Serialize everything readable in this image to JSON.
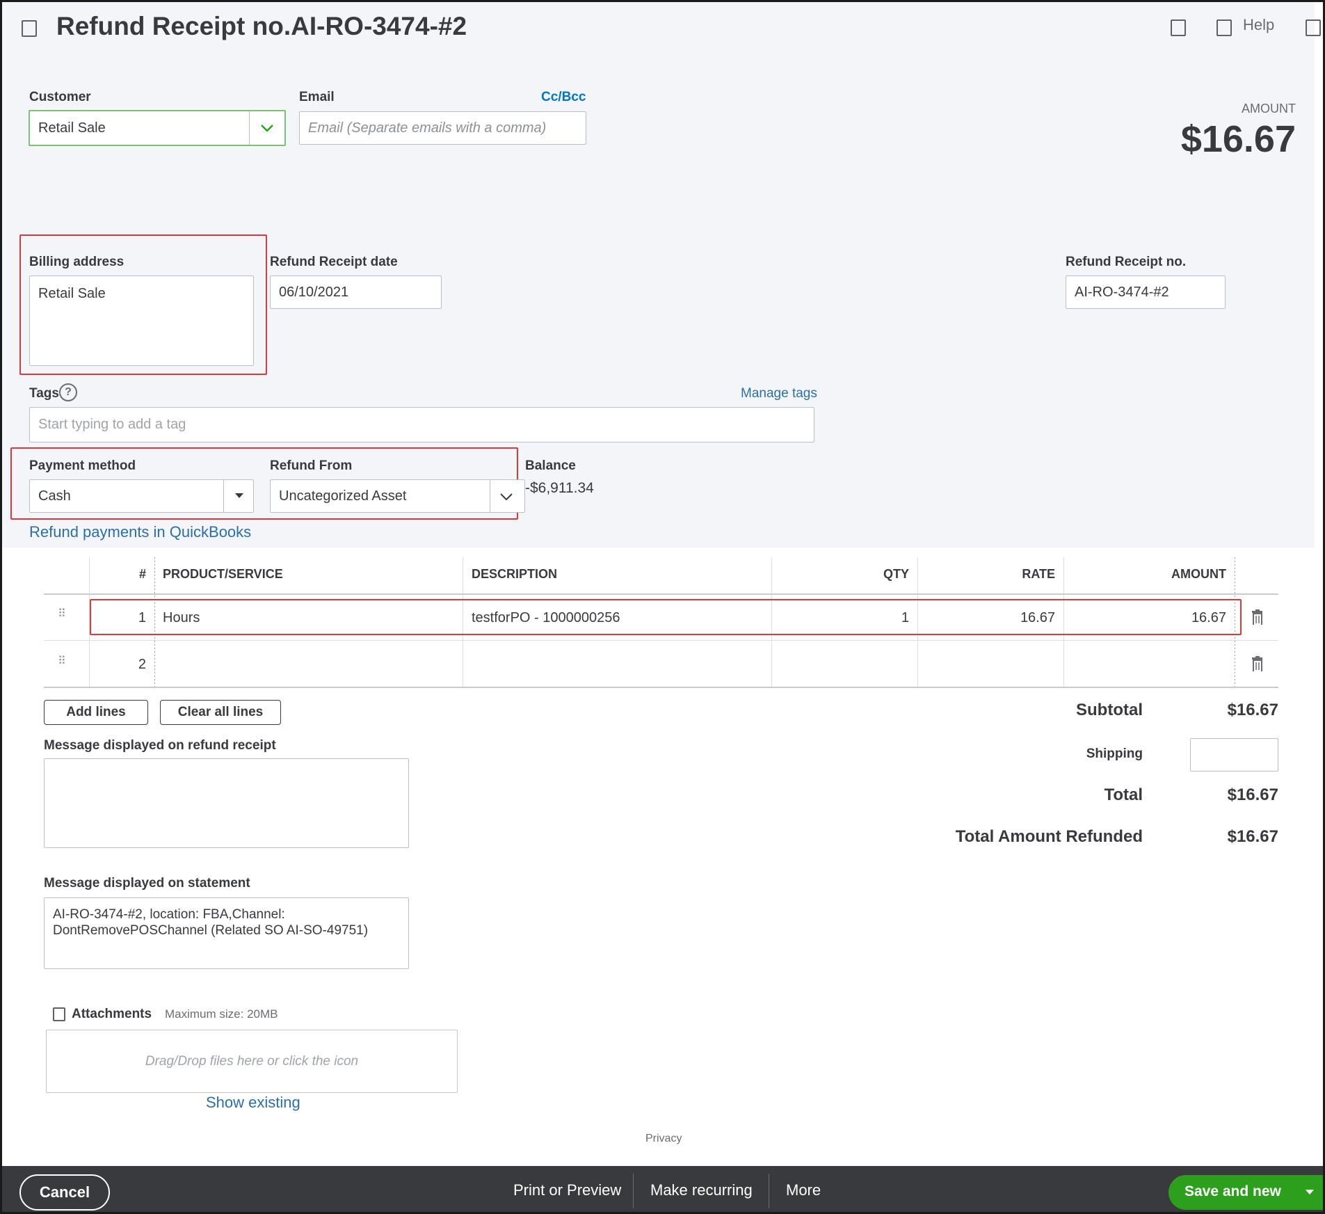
{
  "header": {
    "title": "Refund Receipt no.AI-RO-3474-#2",
    "help_label": "Help"
  },
  "customer": {
    "label": "Customer",
    "value": "Retail Sale"
  },
  "email": {
    "label": "Email",
    "cc_bcc": "Cc/Bcc",
    "placeholder": "Email (Separate emails with a comma)"
  },
  "amount": {
    "label": "AMOUNT",
    "value": "$16.67"
  },
  "billing": {
    "label": "Billing address",
    "value": "Retail Sale"
  },
  "receipt_date": {
    "label": "Refund Receipt date",
    "value": "06/10/2021"
  },
  "receipt_no": {
    "label": "Refund Receipt no.",
    "value": "AI-RO-3474-#2"
  },
  "tags": {
    "label": "Tags",
    "manage": "Manage tags",
    "placeholder": "Start typing to add a tag"
  },
  "payment": {
    "method_label": "Payment method",
    "method_value": "Cash",
    "refund_from_label": "Refund From",
    "refund_from_value": "Uncategorized Asset",
    "balance_label": "Balance",
    "balance_value": "-$6,911.34",
    "refund_link": "Refund payments in QuickBooks"
  },
  "table": {
    "headers": {
      "num": "#",
      "product": "PRODUCT/SERVICE",
      "description": "DESCRIPTION",
      "qty": "QTY",
      "rate": "RATE",
      "amount": "AMOUNT"
    },
    "rows": [
      {
        "num": "1",
        "product": "Hours",
        "description": "testforPO  - 1000000256",
        "qty": "1",
        "rate": "16.67",
        "amount": "16.67"
      },
      {
        "num": "2",
        "product": "",
        "description": "",
        "qty": "",
        "rate": "",
        "amount": ""
      }
    ]
  },
  "buttons": {
    "add_lines": "Add lines",
    "clear_lines": "Clear all lines"
  },
  "totals": {
    "subtotal_label": "Subtotal",
    "subtotal_value": "$16.67",
    "shipping_label": "Shipping",
    "total_label": "Total",
    "total_value": "$16.67",
    "refunded_label": "Total Amount Refunded",
    "refunded_value": "$16.67"
  },
  "messages": {
    "receipt_label": "Message displayed on refund receipt",
    "receipt_value": "",
    "statement_label": "Message displayed on statement",
    "statement_value": "AI-RO-3474-#2, location: FBA,Channel: DontRemovePOSChannel (Related SO AI-SO-49751)"
  },
  "attachments": {
    "label": "Attachments",
    "max_size": "Maximum size: 20MB",
    "drop_text": "Drag/Drop files here or click the icon",
    "show_existing": "Show existing"
  },
  "privacy": "Privacy",
  "footer": {
    "cancel": "Cancel",
    "print_preview": "Print or Preview",
    "make_recurring": "Make recurring",
    "more": "More",
    "save_new": "Save and new"
  },
  "colors": {
    "accent_green": "#2ca01c",
    "link_blue": "#0077c5",
    "highlight_red": "#d93a3a",
    "footer_bg": "#393a3d"
  }
}
